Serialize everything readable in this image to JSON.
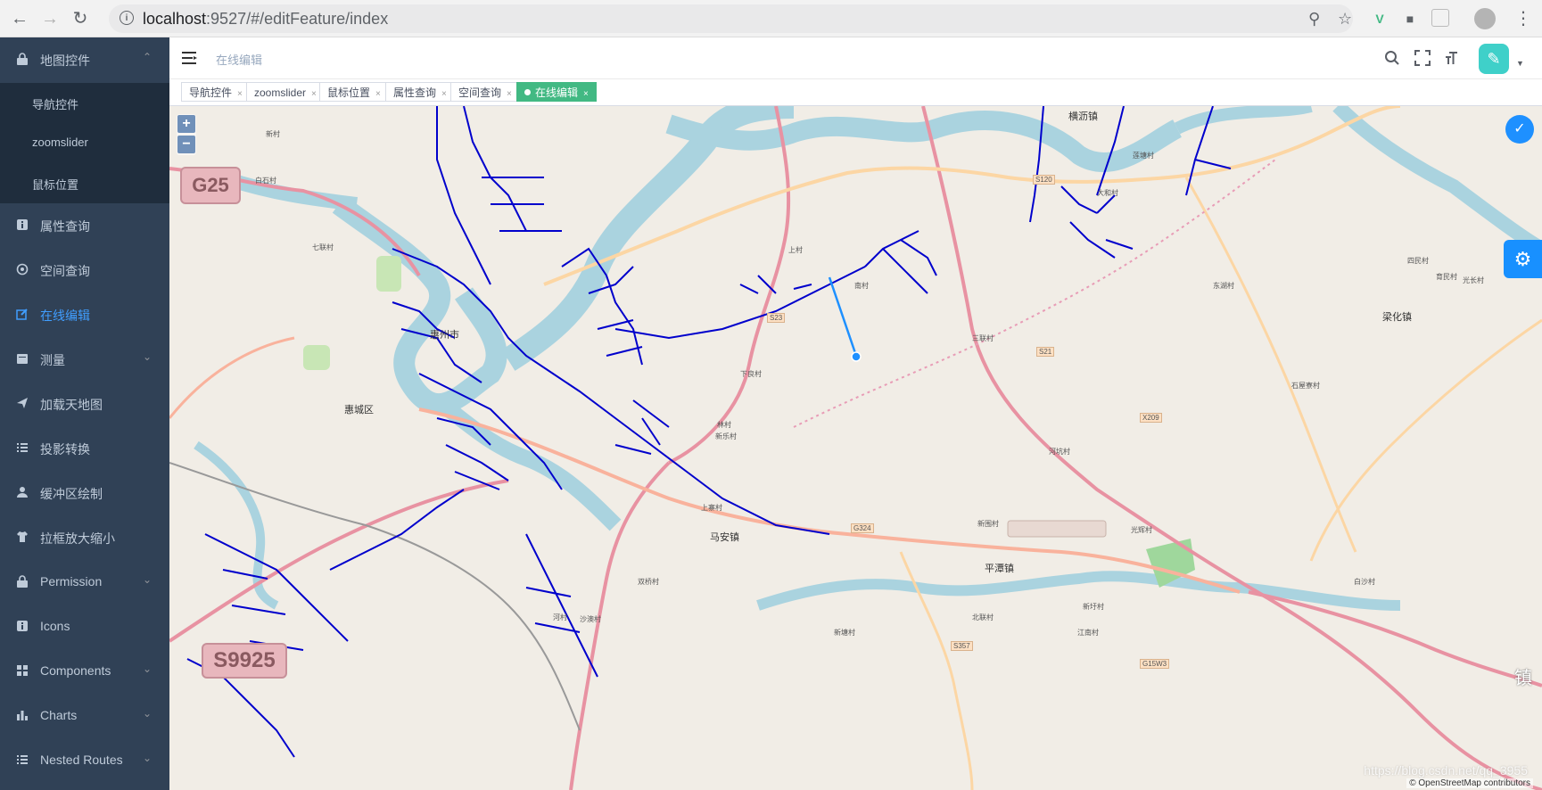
{
  "browser": {
    "url_host": "localhost",
    "url_rest": ":9527/#/editFeature/index"
  },
  "sidebar": {
    "menu": [
      {
        "label": "地图控件",
        "icon": "lock-icon",
        "expanded": true,
        "children": [
          "导航控件",
          "zoomslider",
          "鼠标位置"
        ]
      },
      {
        "label": "属性查询",
        "icon": "info-icon"
      },
      {
        "label": "空间查询",
        "icon": "target-icon"
      },
      {
        "label": "在线编辑",
        "icon": "edit-icon",
        "active": true
      },
      {
        "label": "测量",
        "icon": "calendar-icon",
        "has_children": true
      },
      {
        "label": "加载天地图",
        "icon": "send-icon"
      },
      {
        "label": "投影转换",
        "icon": "list-icon"
      },
      {
        "label": "缓冲区绘制",
        "icon": "user-icon"
      },
      {
        "label": "拉框放大缩小",
        "icon": "shirt-icon"
      },
      {
        "label": "Permission",
        "icon": "lock-icon",
        "has_children": true
      },
      {
        "label": "Icons",
        "icon": "info-icon"
      },
      {
        "label": "Components",
        "icon": "grid-icon",
        "has_children": true
      },
      {
        "label": "Charts",
        "icon": "bar-chart-icon",
        "has_children": true
      },
      {
        "label": "Nested Routes",
        "icon": "list-icon",
        "has_children": true
      }
    ],
    "active_color": "#409eff",
    "bg_color": "#304156"
  },
  "navbar": {
    "breadcrumb": "在线编辑"
  },
  "tags": [
    {
      "label": "导航控件"
    },
    {
      "label": "zoomslider"
    },
    {
      "label": "鼠标位置"
    },
    {
      "label": "属性查询"
    },
    {
      "label": "空间查询"
    },
    {
      "label": "在线编辑",
      "active": true
    }
  ],
  "tag_active_color": "#42b983",
  "map": {
    "zoom_in": "+",
    "zoom_out": "−",
    "attribution": "© OpenStreetMap contributors",
    "watermark": "https://blog.csdn.net/qq_3955",
    "shields": [
      "G25",
      "S9925"
    ],
    "towns": [
      "惠州市",
      "惠城区",
      "马安镇",
      "平潭镇",
      "横沥镇",
      "梁化镇",
      "镇"
    ],
    "villages": [
      "新村",
      "白石村",
      "七联村",
      "上村",
      "南村",
      "新乐村",
      "林村",
      "下良村",
      "双桥村",
      "新塘村",
      "沙澳村",
      "河村",
      "江南村",
      "北联村",
      "新圩村",
      "光辉村",
      "石屋寮村",
      "白沙村",
      "四民村",
      "育民村",
      "光长村",
      "大和村",
      "莲塘村",
      "东湖村",
      "三联村",
      "河坑村",
      "上寨村",
      "新围村"
    ],
    "roads": [
      "G324",
      "S120",
      "S23",
      "S21",
      "S357",
      "X209",
      "G15W3"
    ],
    "feature_line_color": "#1e90ff",
    "edit_network_color": "#0000cc"
  }
}
